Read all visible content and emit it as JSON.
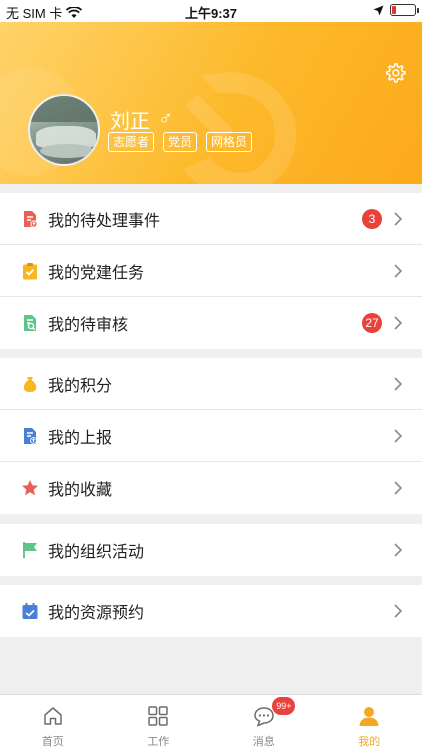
{
  "status_bar": {
    "carrier": "无 SIM 卡",
    "time": "上午9:37"
  },
  "profile": {
    "name": "刘正",
    "gender_symbol": "♂",
    "tags": [
      "志愿者",
      "党员",
      "网格员"
    ]
  },
  "menu_groups": [
    {
      "items": [
        {
          "label": "我的待处理事件",
          "icon": "document-upload-icon",
          "badge": "3"
        },
        {
          "label": "我的党建任务",
          "icon": "clipboard-check-icon",
          "badge": ""
        },
        {
          "label": "我的待审核",
          "icon": "document-search-icon",
          "badge": "27"
        }
      ]
    },
    {
      "items": [
        {
          "label": "我的积分",
          "icon": "money-bag-icon",
          "badge": ""
        },
        {
          "label": "我的上报",
          "icon": "report-icon",
          "badge": ""
        },
        {
          "label": "我的收藏",
          "icon": "star-icon",
          "badge": ""
        }
      ]
    },
    {
      "items": [
        {
          "label": "我的组织活动",
          "icon": "flag-icon",
          "badge": ""
        }
      ]
    },
    {
      "items": [
        {
          "label": "我的资源预约",
          "icon": "calendar-check-icon",
          "badge": ""
        }
      ]
    }
  ],
  "tabbar": {
    "tabs": [
      {
        "label": "首页",
        "icon": "home-icon"
      },
      {
        "label": "工作",
        "icon": "grid-icon"
      },
      {
        "label": "消息",
        "icon": "chat-icon",
        "badge": "99+"
      },
      {
        "label": "我的",
        "icon": "person-icon"
      }
    ],
    "active_index": 3
  },
  "colors": {
    "header_yellow": "#fdb92a",
    "badge_red": "#e8423b",
    "active_tab": "#f5a623"
  }
}
